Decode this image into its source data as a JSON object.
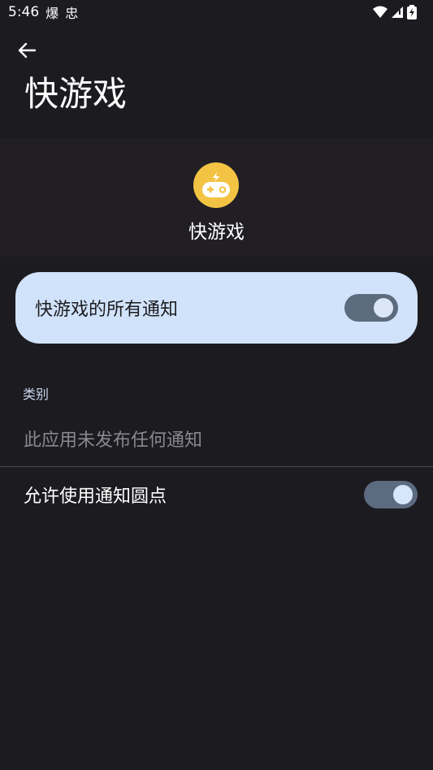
{
  "status_bar": {
    "time": "5:46",
    "notif_icons": [
      "爆",
      "忠"
    ]
  },
  "header": {
    "title": "快游戏"
  },
  "app": {
    "name": "快游戏",
    "icon_color": "#f3c344"
  },
  "main_toggle": {
    "label": "快游戏的所有通知",
    "state": "on"
  },
  "categories": {
    "label": "类别",
    "empty_text": "此应用未发布任何通知"
  },
  "dots_setting": {
    "label": "允许使用通知圆点",
    "state": "on"
  },
  "colors": {
    "background": "#1c1b1f",
    "card_accent": "#d1e3fb",
    "switch_track": "#5c6b80",
    "switch_knob": "#d8e6fb"
  }
}
